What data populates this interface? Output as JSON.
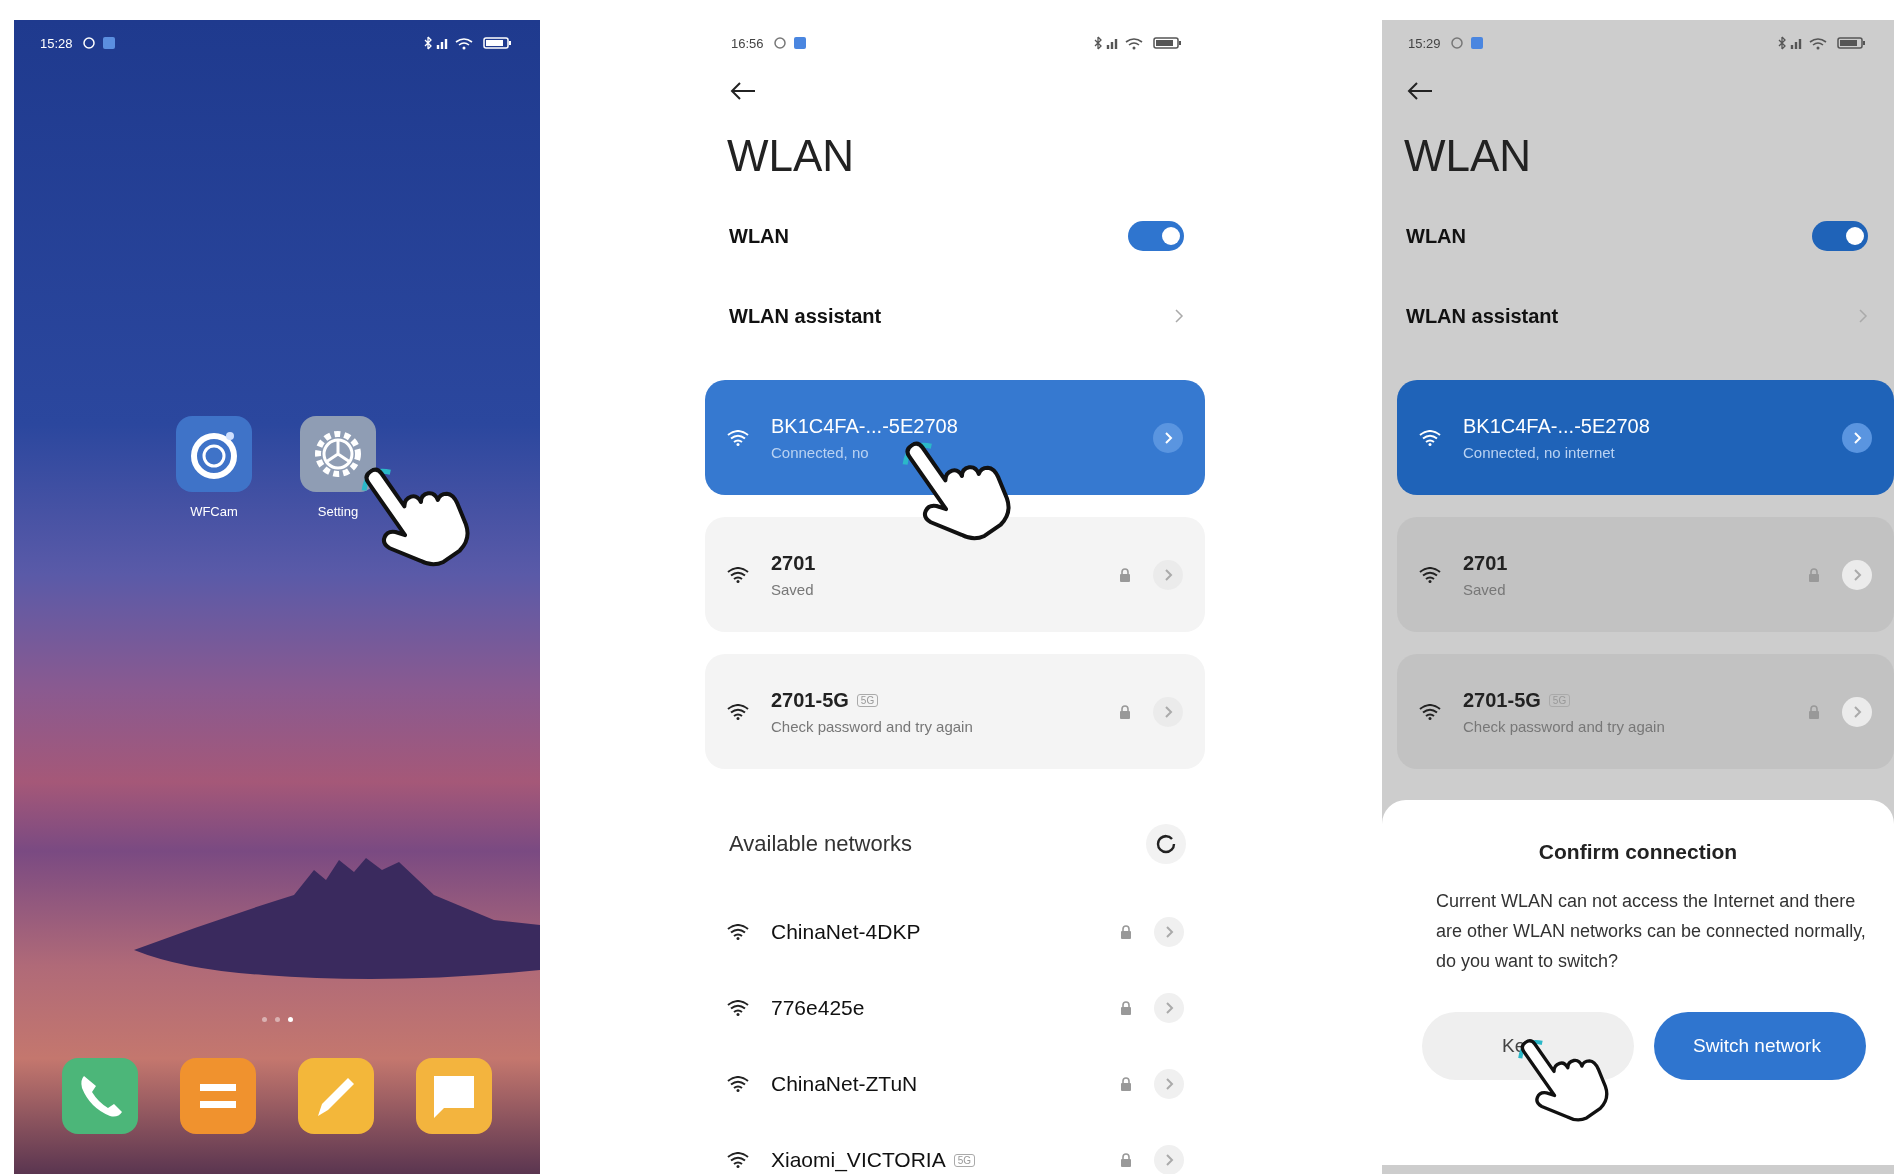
{
  "screens": [
    {
      "kind": "home",
      "status_time": "15:28",
      "apps": [
        {
          "label": "WFCam",
          "kind": "camera",
          "touched": false
        },
        {
          "label": "Setting",
          "kind": "gear",
          "touched": true
        }
      ],
      "pages": [
        {
          "selected": false
        },
        {
          "selected": false
        },
        {
          "selected": true
        }
      ],
      "dock": [
        {
          "kind": "phone",
          "color": "#4cb679"
        },
        {
          "kind": "menu",
          "color": "#f0922e"
        },
        {
          "kind": "pencil",
          "color": "#f3b73a"
        },
        {
          "kind": "message",
          "color": "#f3b43e"
        }
      ]
    },
    {
      "kind": "wlan",
      "status_time": "16:56",
      "title": "WLAN",
      "toggle": {
        "label": "WLAN",
        "on": true
      },
      "assistant": "WLAN assistant",
      "saved": [
        {
          "name": "BK1C4FA-...-5E2708",
          "status": "Connected, no",
          "connected": true,
          "touched": true
        },
        {
          "name": "2701",
          "status": "Saved",
          "connected": false,
          "touched": false
        },
        {
          "name": "2701-5G",
          "badge": "5G",
          "status": "Check password and try again",
          "connected": false,
          "touched": false
        }
      ],
      "available_title": "Available networks",
      "available": [
        {
          "name": "ChinaNet-4DKP"
        },
        {
          "name": "776e425e"
        },
        {
          "name": "ChinaNet-ZTuN"
        },
        {
          "name": "Xiaomi_VICTORIA",
          "badge": "5G"
        }
      ]
    },
    {
      "kind": "wlan",
      "status_time": "15:29",
      "title": "WLAN",
      "toggle": {
        "label": "WLAN",
        "on": true
      },
      "assistant": "WLAN assistant",
      "saved": [
        {
          "name": "BK1C4FA-...-5E2708",
          "status": "Connected, no internet",
          "connected": true,
          "touched": false
        },
        {
          "name": "2701",
          "status": "Saved",
          "connected": false,
          "touched": false
        },
        {
          "name": "2701-5G",
          "badge": "5G",
          "status": "Check password and try again",
          "connected": false,
          "touched": false
        }
      ],
      "dialog": {
        "title": "Confirm connection",
        "message": "Current WLAN can not access the Internet and there are other WLAN networks can be connected normally, do you want to switch?",
        "buttons": [
          {
            "label": "Ke",
            "primary": false,
            "touched": true
          },
          {
            "label": "Switch network",
            "primary": true,
            "touched": false
          }
        ]
      }
    }
  ]
}
